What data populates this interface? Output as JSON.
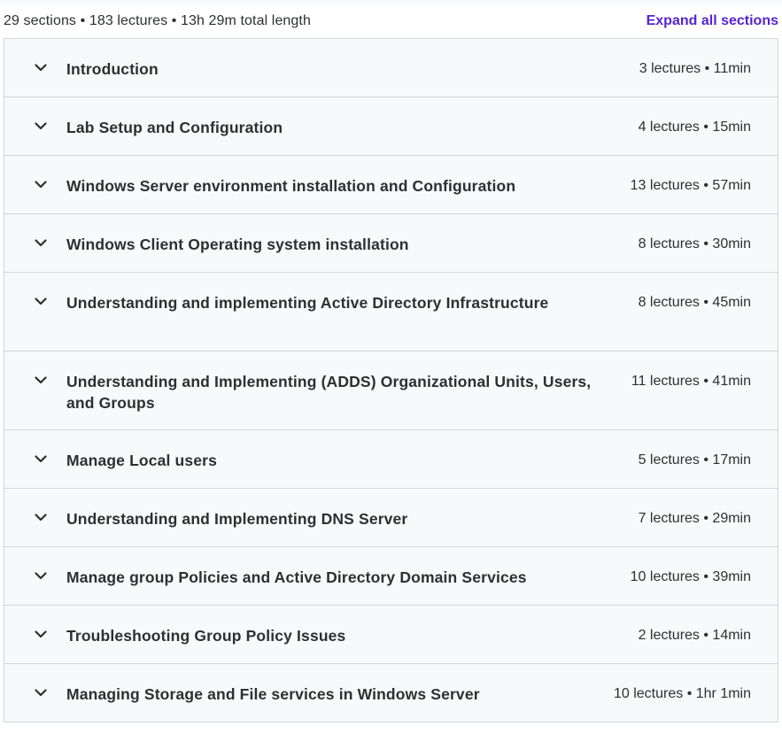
{
  "curriculum": {
    "summary": "29 sections • 183 lectures • 13h 29m total length",
    "expand_all_label": "Expand all sections",
    "sections": [
      {
        "title": "Introduction",
        "meta": "3 lectures • 11min"
      },
      {
        "title": "Lab Setup and Configuration",
        "meta": "4 lectures • 15min"
      },
      {
        "title": "Windows Server environment installation and Configuration",
        "meta": "13 lectures • 57min"
      },
      {
        "title": "Windows Client Operating system installation",
        "meta": "8 lectures • 30min"
      },
      {
        "title": "Understanding and implementing Active Directory Infrastructure",
        "meta": "8 lectures • 45min"
      },
      {
        "title": "Understanding and Implementing (ADDS) Organizational Units, Users, and Groups",
        "meta": "11 lectures • 41min"
      },
      {
        "title": "Manage Local users",
        "meta": "5 lectures • 17min"
      },
      {
        "title": "Understanding and Implementing DNS Server",
        "meta": "7 lectures • 29min"
      },
      {
        "title": "Manage group Policies and Active Directory Domain Services",
        "meta": "10 lectures • 39min"
      },
      {
        "title": "Troubleshooting Group Policy Issues",
        "meta": "2 lectures • 14min"
      },
      {
        "title": "Managing Storage and File services in Windows Server",
        "meta": "10 lectures • 1hr 1min"
      }
    ]
  },
  "colors": {
    "accent": "#5624d0",
    "section_background": "#f7f9fa",
    "border": "#d1d7dc",
    "text": "#2d2f31"
  },
  "icons": {
    "section_toggle": "chevron-down-icon"
  }
}
